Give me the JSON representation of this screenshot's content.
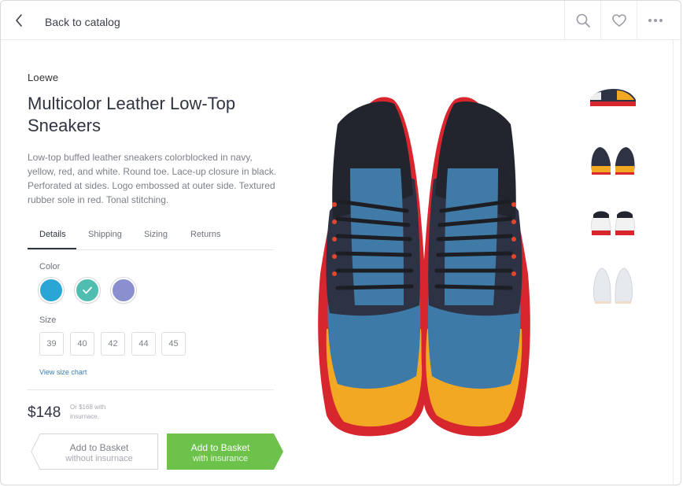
{
  "header": {
    "back_label": "Back to catalog",
    "icons": {
      "back": "chevron-left-icon",
      "search": "search-icon",
      "favorite": "heart-icon",
      "more": "more-horizontal-icon"
    }
  },
  "product": {
    "brand": "Loewe",
    "title": "Multicolor Leather Low-Top Sneakers",
    "description": "Low-top buffed leather sneakers colorblocked in navy, yellow, red, and white. Round toe. Lace-up closure in black. Perforated at sides. Logo embossed at outer side. Textured rubber sole in red. Tonal stitching."
  },
  "tabs": [
    {
      "label": "Details",
      "active": true
    },
    {
      "label": "Shipping",
      "active": false
    },
    {
      "label": "Sizing",
      "active": false
    },
    {
      "label": "Returns",
      "active": false
    }
  ],
  "color": {
    "label": "Color",
    "options": [
      {
        "name": "blue",
        "hex": "#2aa6d6",
        "selected": false
      },
      {
        "name": "teal",
        "hex": "#4fbeb0",
        "selected": true
      },
      {
        "name": "lavender",
        "hex": "#8a8fd0",
        "selected": false
      }
    ]
  },
  "size": {
    "label": "Size",
    "options": [
      "39",
      "40",
      "42",
      "44",
      "45"
    ],
    "chart_link": "View size chart"
  },
  "pricing": {
    "price": "$148",
    "note": "Or $168 with insurnace."
  },
  "actions": {
    "without": {
      "line1": "Add to Basket",
      "line2": "without insurnace"
    },
    "with": {
      "line1": "Add to Basket",
      "line2": "with insurance"
    }
  },
  "colors": {
    "accent_green": "#6cc24a",
    "text_dark": "#2f3440",
    "link_blue": "#3a7bb8"
  },
  "thumbnails": [
    "side-view",
    "front-pair",
    "back-pair",
    "white-pair"
  ]
}
